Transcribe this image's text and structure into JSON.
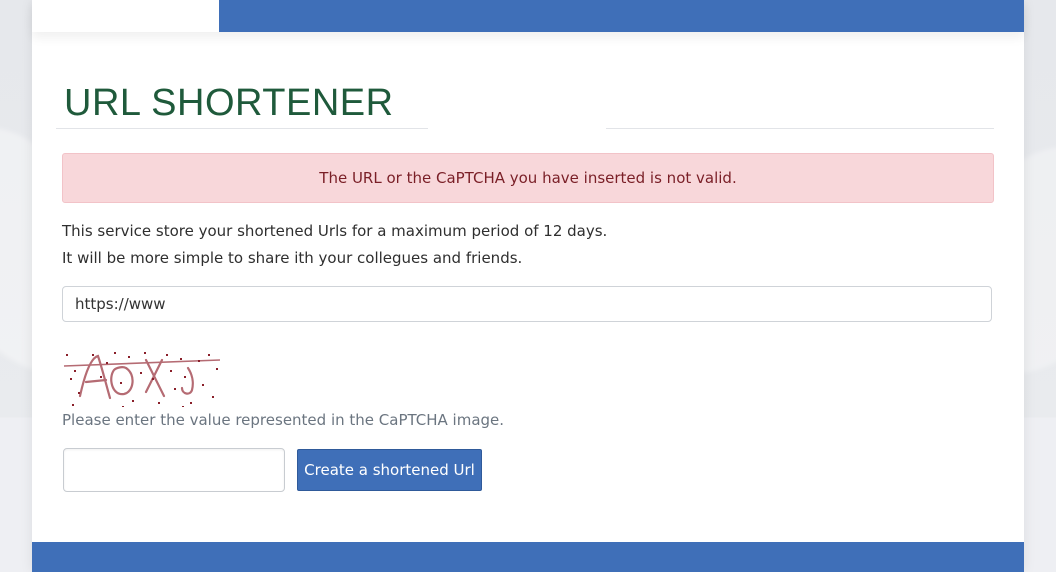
{
  "page": {
    "title": "URL SHORTENER"
  },
  "alert": {
    "message": "The URL or the CaPTCHA you have inserted is not valid."
  },
  "info": {
    "line1": "This service store your shortened Urls for a maximum period of 12 days.",
    "line2": "It will be more simple to share ith your collegues and friends."
  },
  "url_input": {
    "value": "https://www",
    "placeholder": ""
  },
  "captcha": {
    "help_text": "Please enter the value represented in the CaPTCHA image.",
    "input_value": ""
  },
  "actions": {
    "submit_label": "Create a shortened Url"
  },
  "colors": {
    "accent": "#3f6fb8",
    "title": "#1f5a3b",
    "alert_bg": "#f8d7da",
    "alert_text": "#7a1f27"
  }
}
